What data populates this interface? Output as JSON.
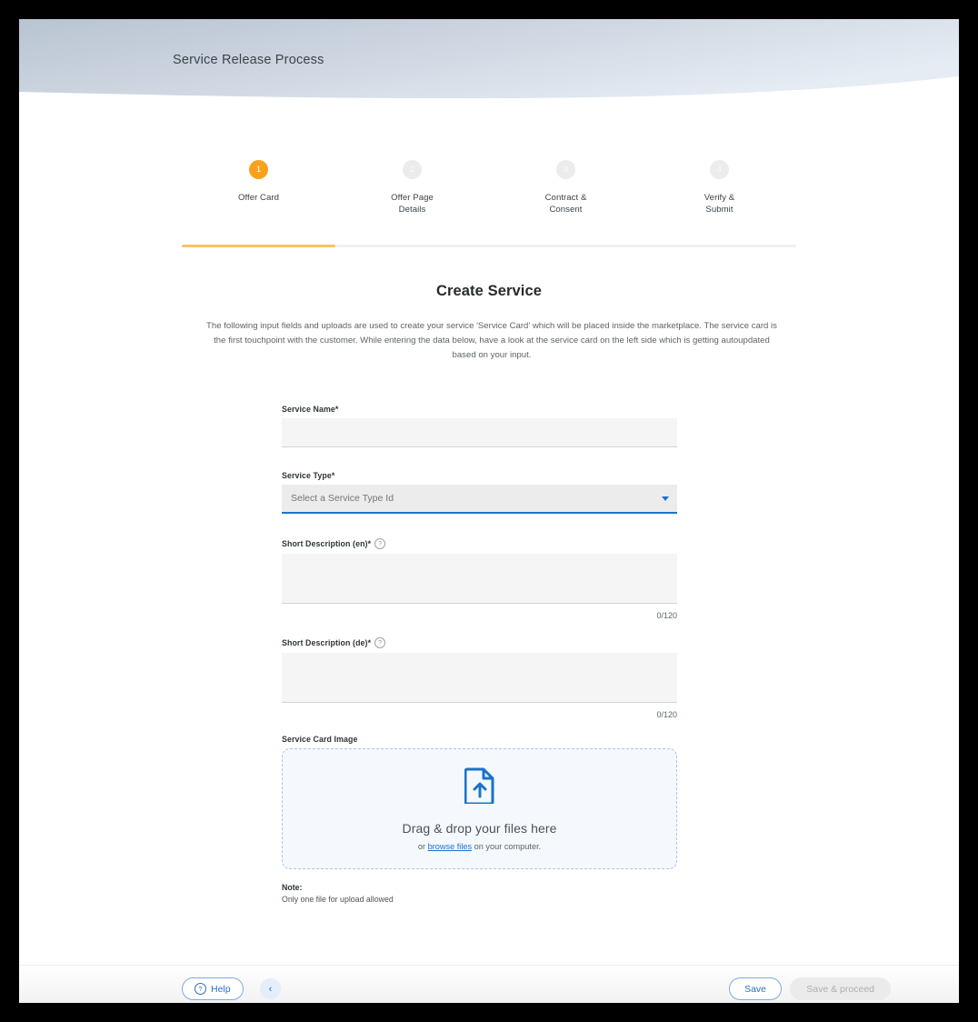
{
  "header": {
    "title": "Service Release Process"
  },
  "stepper": {
    "active_index": 0,
    "progress_percent": 25,
    "active_color": "#f9a11b",
    "steps": [
      {
        "number": "1",
        "label": "Offer Card"
      },
      {
        "number": "2",
        "label": "Offer Page\nDetails"
      },
      {
        "number": "3",
        "label": "Contract &\nConsent"
      },
      {
        "number": "4",
        "label": "Verify &\nSubmit"
      }
    ]
  },
  "main": {
    "title": "Create Service",
    "description": "The following input fields and uploads are used to create your service 'Service Card' which will be placed inside the marketplace. The service card is the first touchpoint with the customer. While entering the data below, have a look at the service card on the left side which is getting autoupdated based on your input."
  },
  "form": {
    "service_name": {
      "label": "Service Name*",
      "value": "",
      "placeholder": ""
    },
    "service_type": {
      "label": "Service Type*",
      "value": "",
      "placeholder": "Select a Service Type Id",
      "caret": "chevron-down-icon"
    },
    "short_description_en": {
      "label": "Short Description (en)*",
      "help": "?",
      "value": "",
      "placeholder": "",
      "counter": "0/120"
    },
    "short_description_de": {
      "label": "Short Description (de)*",
      "help": "?",
      "value": "",
      "placeholder": "",
      "counter": "0/120"
    },
    "service_card_image": {
      "label": "Service Card Image",
      "dropzone_icon": "file-upload-icon",
      "dropzone_title": "Drag & drop your files here",
      "dropzone_sub_prefix": "or ",
      "dropzone_link": "browse files",
      "dropzone_sub_suffix": " on your computer.",
      "note_title": "Note:",
      "note_text": "Only one file for upload allowed"
    }
  },
  "footer": {
    "help_icon": "question-circle-icon",
    "help_label": "Help",
    "collapse_icon": "chevron-left-icon",
    "collapse_label": "‹",
    "save_label": "Save",
    "proceed_label": "Save & proceed"
  }
}
